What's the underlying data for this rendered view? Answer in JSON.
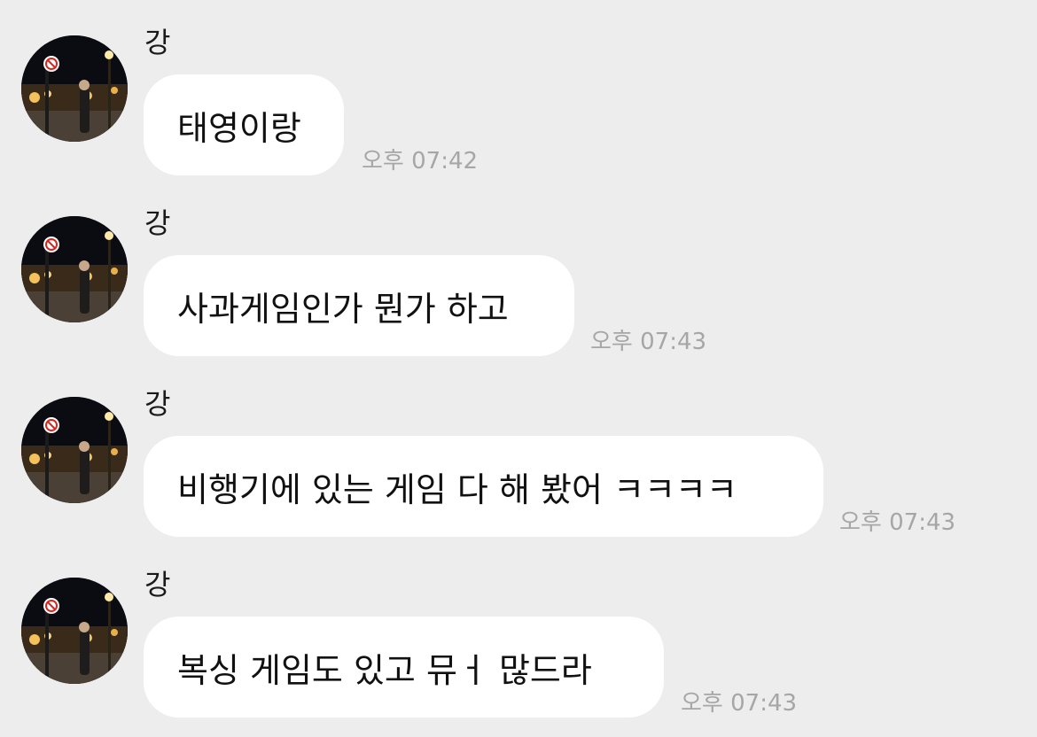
{
  "colors": {
    "background": "#ededed",
    "bubble": "#ffffff",
    "timestamp": "#a6a6a6",
    "text": "#111111"
  },
  "messages": [
    {
      "sender": "강",
      "avatar_icon": "profile-photo-night-street",
      "text": "태영이랑",
      "time": "오후 07:42"
    },
    {
      "sender": "강",
      "avatar_icon": "profile-photo-night-street",
      "text": "사과게임인가 뭔가 하고",
      "time": "오후 07:43"
    },
    {
      "sender": "강",
      "avatar_icon": "profile-photo-night-street",
      "text": "비행기에 있는 게임 다 해 봤어 ㅋㅋㅋㅋ",
      "time": "오후 07:43"
    },
    {
      "sender": "강",
      "avatar_icon": "profile-photo-night-street",
      "text": "복싱 게임도 있고 뮤ㅓ 많드라",
      "time": "오후 07:43"
    }
  ]
}
